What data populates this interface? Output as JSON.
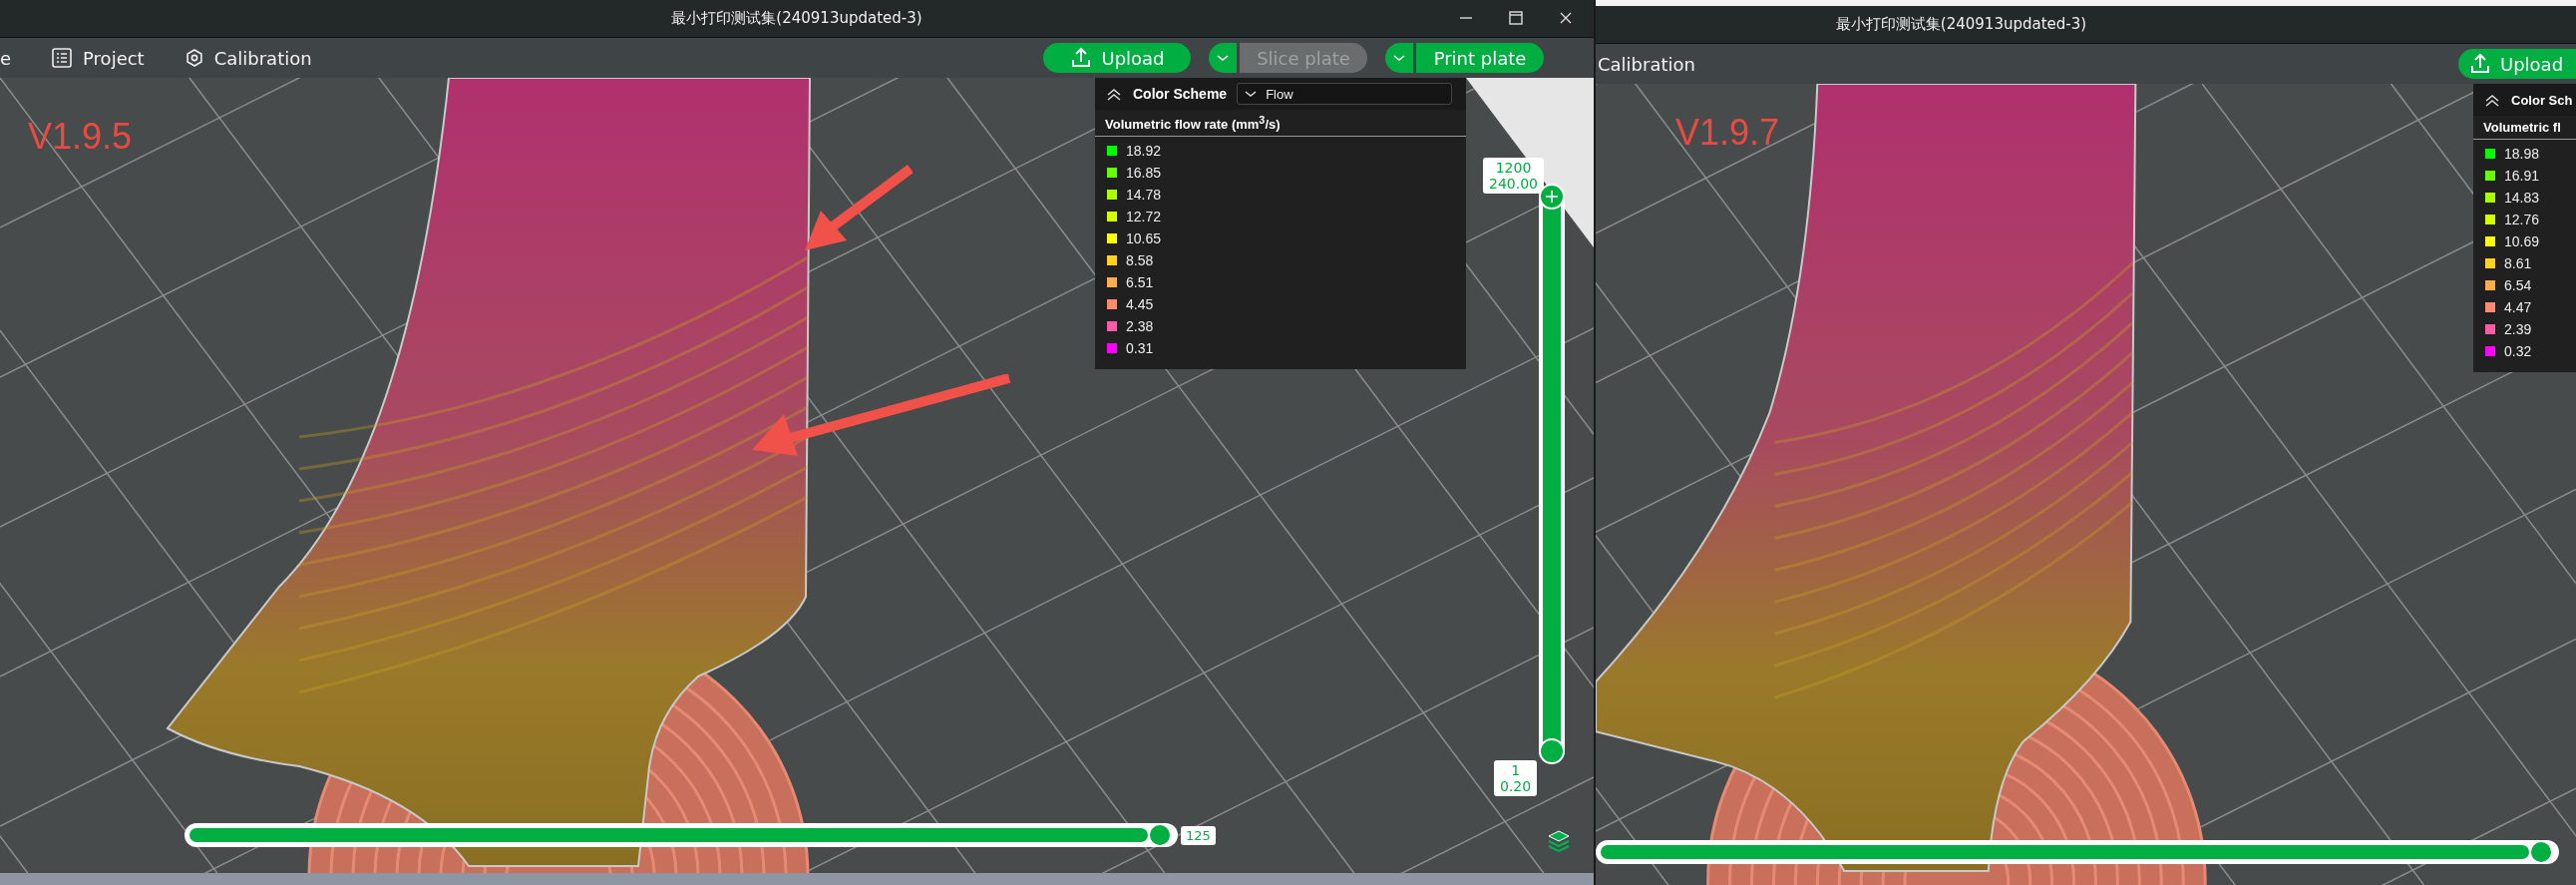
{
  "windows": [
    {
      "title": "最小打印测试集(240913updated-3)",
      "menu_items": [
        {
          "label": "e",
          "kind": "plain"
        },
        {
          "label": "Project",
          "kind": "project"
        },
        {
          "label": "Calibration",
          "kind": "calibration"
        }
      ],
      "buttons": [
        {
          "label": "Upload",
          "kind": "upload"
        },
        {
          "label": "Slice plate",
          "kind": "split",
          "disabled": true
        },
        {
          "label": "Print plate",
          "kind": "split",
          "disabled": false
        }
      ],
      "version_label": "V1.9.5",
      "legend": {
        "title": "Color Scheme",
        "dropdown": "Flow",
        "heading": "Volumetric flow rate (mm$^{3}$/s)",
        "items": [
          {
            "value": "18.92",
            "color": "#00ff00"
          },
          {
            "value": "16.85",
            "color": "#66ff00"
          },
          {
            "value": "14.78",
            "color": "#aaff00"
          },
          {
            "value": "12.72",
            "color": "#d4ff00"
          },
          {
            "value": "10.65",
            "color": "#ffff00"
          },
          {
            "value": "8.58",
            "color": "#ffd21f"
          },
          {
            "value": "6.51",
            "color": "#ffad4a"
          },
          {
            "value": "4.45",
            "color": "#ff8a70"
          },
          {
            "value": "2.38",
            "color": "#ff5aa5"
          },
          {
            "value": "0.31",
            "color": "#ff00ff"
          }
        ]
      },
      "layer_slider": {
        "level": 1,
        "upper": [
          "1200",
          "240.00"
        ],
        "lower": [
          "1",
          "0.20"
        ]
      },
      "move_slider": {
        "level": 1,
        "label": "125"
      }
    },
    {
      "title": "最小打印测试集(240913updated-3)",
      "menu_items": [
        {
          "label": "Calibration",
          "kind": "plain"
        }
      ],
      "buttons": [
        {
          "label": "Upload",
          "kind": "upload"
        }
      ],
      "version_label": "V1.9.7",
      "legend": {
        "title": "Color Sch",
        "heading": "Volumetric fl",
        "items": [
          {
            "value": "18.98",
            "color": "#00ff00"
          },
          {
            "value": "16.91",
            "color": "#66ff00"
          },
          {
            "value": "14.83",
            "color": "#aaff00"
          },
          {
            "value": "12.76",
            "color": "#d4ff00"
          },
          {
            "value": "10.69",
            "color": "#ffff00"
          },
          {
            "value": "8.61",
            "color": "#ffd21f"
          },
          {
            "value": "6.54",
            "color": "#ffad4a"
          },
          {
            "value": "4.47",
            "color": "#ff8a70"
          },
          {
            "value": "2.39",
            "color": "#ff5aa5"
          },
          {
            "value": "0.32",
            "color": "#ff00ff"
          }
        ]
      },
      "move_slider": {
        "level": 1
      }
    }
  ]
}
